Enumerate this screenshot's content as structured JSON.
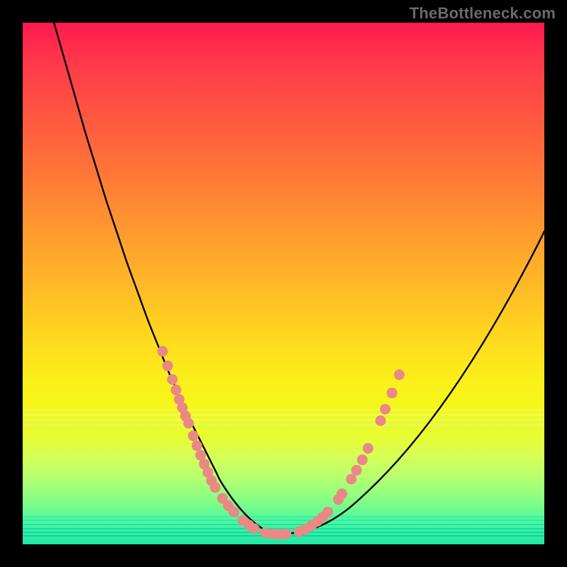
{
  "watermark": "TheBottleneck.com",
  "colors": {
    "frame": "#000000",
    "curve": "#000000",
    "dot_fill": "#e98885",
    "dot_stroke": "#d06864"
  },
  "chart_data": {
    "type": "line",
    "title": "",
    "xlabel": "",
    "ylabel": "",
    "xlim": [
      0,
      100
    ],
    "ylim": [
      0,
      100
    ],
    "grid": false,
    "legend": false,
    "series": [
      {
        "name": "curve",
        "x": [
          6,
          8,
          10,
          12,
          14,
          16,
          18,
          20,
          22,
          24,
          26,
          28,
          30,
          32,
          34,
          35,
          36,
          37,
          38,
          40,
          42,
          44,
          46,
          48,
          50,
          54,
          58,
          62,
          66,
          70,
          74,
          78,
          82,
          86,
          90,
          94,
          98,
          100
        ],
        "y": [
          100,
          93,
          86,
          79,
          72.5,
          66,
          60,
          54,
          48.5,
          43,
          38,
          33,
          28.5,
          24,
          20,
          18,
          16,
          14,
          12,
          9,
          6.5,
          4.5,
          3,
          2,
          2,
          2.5,
          4,
          6.5,
          10,
          14,
          18.5,
          23.5,
          29,
          35,
          41.5,
          48.5,
          56,
          60
        ]
      }
    ],
    "annotations": {
      "dots": [
        {
          "x": 26.8,
          "y": 37.0
        },
        {
          "x": 27.8,
          "y": 34.2
        },
        {
          "x": 28.7,
          "y": 31.6
        },
        {
          "x": 29.4,
          "y": 29.6
        },
        {
          "x": 30.0,
          "y": 27.8
        },
        {
          "x": 30.6,
          "y": 26.2
        },
        {
          "x": 31.2,
          "y": 24.6
        },
        {
          "x": 31.8,
          "y": 23.2
        },
        {
          "x": 32.7,
          "y": 20.8
        },
        {
          "x": 33.4,
          "y": 18.9
        },
        {
          "x": 34.1,
          "y": 17.1
        },
        {
          "x": 34.8,
          "y": 15.4
        },
        {
          "x": 35.5,
          "y": 13.8
        },
        {
          "x": 36.2,
          "y": 12.2
        },
        {
          "x": 36.9,
          "y": 10.9
        },
        {
          "x": 38.3,
          "y": 8.8
        },
        {
          "x": 39.4,
          "y": 7.4
        },
        {
          "x": 40.5,
          "y": 6.2
        },
        {
          "x": 42.2,
          "y": 4.6
        },
        {
          "x": 43.4,
          "y": 3.7
        },
        {
          "x": 44.4,
          "y": 3.0
        },
        {
          "x": 46.5,
          "y": 2.2
        },
        {
          "x": 48.0,
          "y": 2.0
        },
        {
          "x": 49.2,
          "y": 1.9
        },
        {
          "x": 50.5,
          "y": 2.0
        },
        {
          "x": 53.0,
          "y": 2.4
        },
        {
          "x": 54.2,
          "y": 2.9
        },
        {
          "x": 55.4,
          "y": 3.6
        },
        {
          "x": 56.5,
          "y": 4.4
        },
        {
          "x": 57.5,
          "y": 5.2
        },
        {
          "x": 58.5,
          "y": 6.2
        },
        {
          "x": 60.5,
          "y": 8.6
        },
        {
          "x": 61.2,
          "y": 9.7
        },
        {
          "x": 63.0,
          "y": 12.5
        },
        {
          "x": 64.0,
          "y": 14.2
        },
        {
          "x": 65.1,
          "y": 16.2
        },
        {
          "x": 66.2,
          "y": 18.4
        },
        {
          "x": 68.6,
          "y": 23.7
        },
        {
          "x": 69.5,
          "y": 25.9
        },
        {
          "x": 70.8,
          "y": 29.0
        },
        {
          "x": 72.2,
          "y": 32.5
        }
      ],
      "dot_radius_px": 7.5
    },
    "gradient_bands": [
      {
        "y": 74.0,
        "color": "#f6f94a"
      },
      {
        "y": 75.0,
        "color": "#eefb5c"
      },
      {
        "y": 76.0,
        "color": "#e3fc6e"
      },
      {
        "y": 77.0,
        "color": "#d6fe7e"
      },
      {
        "y": 94.5,
        "color": "#3ef0a5"
      },
      {
        "y": 95.3,
        "color": "#2ceaa9"
      },
      {
        "y": 96.1,
        "color": "#1de3ab"
      },
      {
        "y": 96.9,
        "color": "#15dca8"
      },
      {
        "y": 97.6,
        "color": "#12d6a4"
      },
      {
        "y": 98.3,
        "color": "#10d09f"
      }
    ]
  }
}
